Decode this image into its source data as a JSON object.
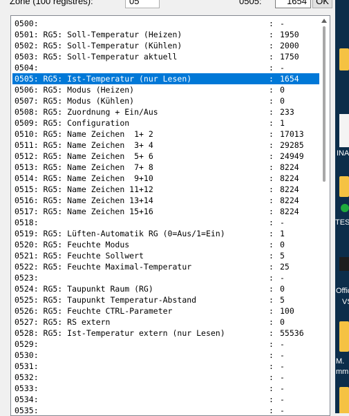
{
  "toolbar": {
    "zone_label": "Zone (100 registres):",
    "zone_value": "05",
    "address_label": "0505:",
    "address_value": "1654",
    "ok_label": "OK"
  },
  "registers": [
    {
      "name": "0500:",
      "value": "-"
    },
    {
      "name": "0501: RG5: Soll-Temperatur (Heizen)",
      "value": "1950"
    },
    {
      "name": "0502: RG5: Soll-Temperatur (Kühlen)",
      "value": "2000"
    },
    {
      "name": "0503: RG5: Soll-Temperatur aktuell",
      "value": "1750"
    },
    {
      "name": "0504:",
      "value": "-"
    },
    {
      "name": "0505: RG5: Ist-Temperatur (nur Lesen)",
      "value": "1654"
    },
    {
      "name": "0506: RG5: Modus (Heizen)",
      "value": "0"
    },
    {
      "name": "0507: RG5: Modus (Kühlen)",
      "value": "0"
    },
    {
      "name": "0508: RG5: Zuordnung + Ein/Aus",
      "value": "233"
    },
    {
      "name": "0509: RG5: Configuration",
      "value": "1"
    },
    {
      "name": "0510: RG5: Name Zeichen  1+ 2",
      "value": "17013"
    },
    {
      "name": "0511: RG5: Name Zeichen  3+ 4",
      "value": "29285"
    },
    {
      "name": "0512: RG5: Name Zeichen  5+ 6",
      "value": "24949"
    },
    {
      "name": "0513: RG5: Name Zeichen  7+ 8",
      "value": "8224"
    },
    {
      "name": "0514: RG5: Name Zeichen  9+10",
      "value": "8224"
    },
    {
      "name": "0515: RG5: Name Zeichen 11+12",
      "value": "8224"
    },
    {
      "name": "0516: RG5: Name Zeichen 13+14",
      "value": "8224"
    },
    {
      "name": "0517: RG5: Name Zeichen 15+16",
      "value": "8224"
    },
    {
      "name": "0518:",
      "value": "-"
    },
    {
      "name": "0519: RG5: Lüften-Automatik RG (0=Aus/1=Ein)",
      "value": "1"
    },
    {
      "name": "0520: RG5: Feuchte Modus",
      "value": "0"
    },
    {
      "name": "0521: RG5: Feuchte Sollwert",
      "value": "5"
    },
    {
      "name": "0522: RG5: Feuchte Maximal-Temperatur",
      "value": "25"
    },
    {
      "name": "0523:",
      "value": "-"
    },
    {
      "name": "0524: RG5: Taupunkt Raum (RG)",
      "value": "0"
    },
    {
      "name": "0525: RG5: Taupunkt Temperatur-Abstand",
      "value": "5"
    },
    {
      "name": "0526: RG5: Feuchte CTRL-Parameter",
      "value": "100"
    },
    {
      "name": "0527: RG5: RS extern",
      "value": "0"
    },
    {
      "name": "0528: RG5: Ist-Temperatur extern (nur Lesen)",
      "value": "55536"
    },
    {
      "name": "0529:",
      "value": "-"
    },
    {
      "name": "0530:",
      "value": "-"
    },
    {
      "name": "0531:",
      "value": "-"
    },
    {
      "name": "0532:",
      "value": "-"
    },
    {
      "name": "0533:",
      "value": "-"
    },
    {
      "name": "0534:",
      "value": "-"
    },
    {
      "name": "0535:",
      "value": "-"
    }
  ],
  "separator": ":",
  "selected_index": 5,
  "desktop": {
    "label_ina": "INA",
    "label_test": "TEST",
    "label_offi": "Offic",
    "label_vs": "VS",
    "label_m": "M.",
    "label_mm": "mm"
  },
  "colors": {
    "selection": "#0078d7",
    "desktop_background": "#0c2d4a"
  }
}
